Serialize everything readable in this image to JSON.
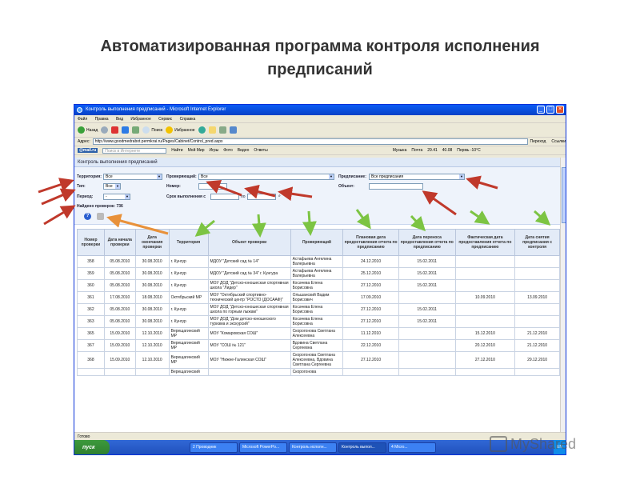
{
  "slide": {
    "title_line1": "Автоматизированная программа контроля исполнения",
    "title_line2": "предписаний"
  },
  "window": {
    "title": "Контроль выполнения предписаний - Microsoft Internet Explorer",
    "menu": [
      "Файл",
      "Правка",
      "Вид",
      "Избранное",
      "Сервис",
      "Справка"
    ],
    "toolbar": [
      "Назад",
      "Поиск",
      "Избранное"
    ],
    "address_label": "Адрес:",
    "address_value": "http://www.goodmedrabot.permkrai.ru/Pages/Cabinet/Control_pred.aspx",
    "go_label": "Переход",
    "links_label": "Ссылки",
    "links": {
      "mail": "@mail.ru",
      "search_placeholder": "Поиск в Интернете",
      "find": "Найти",
      "items": [
        "Мой Мир",
        "Игры",
        "Фото",
        "Видео",
        "Ответы",
        "Музыка",
        "Почта",
        "29.41",
        "40.08",
        "Пермь -10°C"
      ]
    }
  },
  "page": {
    "header": "Контроль выполнения предписаний",
    "filters": {
      "territory_label": "Территория:",
      "territory_value": "Все",
      "inspector_label": "Проверяющий:",
      "inspector_value": "Все",
      "prescription_label": "Предписание:",
      "prescription_value": "Все предписания",
      "type_label": "Тип:",
      "type_value": "Все",
      "number_label": "Номер:",
      "object_label": "Объект:",
      "period_label": "Период:",
      "period_value": "-",
      "deadline_label": "Срок выполнения с",
      "deadline_to": "по",
      "found": "Найдено проверок: 736"
    },
    "columns": [
      "Номер проверки",
      "Дата начала проверки",
      "Дата окончания проверки",
      "Территория",
      "Объект проверки",
      "Проверяющий",
      "Плановая дата предоставления отчета по предписанию",
      "Дата переноса предоставления отчета по предписанию",
      "Фактическая дата предоставления отчета по предписанию",
      "Дата снятия предписания с контроля"
    ],
    "rows": [
      [
        "358",
        "05.08.2010",
        "30.08.2010",
        "г. Кунгур",
        "МДОУ \"Детский сад № 14\"",
        "Астафьева Ангелина Валерьевна",
        "24.12.2010",
        "15.02.2011",
        "",
        ""
      ],
      [
        "359",
        "05.08.2010",
        "30.08.2010",
        "г. Кунгур",
        "МДОУ \"Детский сад № 34\" г. Кунгура",
        "Астафьева Ангелина Валерьевна",
        "25.12.2010",
        "15.02.2011",
        "",
        ""
      ],
      [
        "360",
        "05.08.2010",
        "30.08.2010",
        "г. Кунгур",
        "МОУ ДОД \"Детско-юношеская спортивная школа \"Лидер\"",
        "Косачева Елена Борисовна",
        "27.12.2010",
        "15.02.2011",
        "",
        ""
      ],
      [
        "361",
        "17.08.2010",
        "18.08.2010",
        "Октябрьский МР",
        "МОУ \"Октябрьский спортивно-технический центр \"РОСТО (ДОСААФ)\"",
        "Ольшанский Вадим Борисович",
        "17.09.2010",
        "",
        "10.09.2010",
        "13.09.2010"
      ],
      [
        "362",
        "05.08.2010",
        "30.08.2010",
        "г. Кунгур",
        "МОУ ДОД \"Детско-юношеская спортивная школа по горным лыжам\"",
        "Косачева Елена Борисовна",
        "27.12.2010",
        "15.02.2011",
        "",
        ""
      ],
      [
        "363",
        "05.08.2010",
        "30.08.2010",
        "г. Кунгур",
        "МОУ ДОД \"Дом детско-юношеского туризма и экскурсий\"",
        "Косачева Елена Борисовна",
        "27.12.2010",
        "15.02.2011",
        "",
        ""
      ],
      [
        "365",
        "15.09.2010",
        "12.10.2010",
        "Верещагинский МР",
        "МОУ \"Комаровская СОШ\"",
        "Скорогонова Светлана Алексеевна",
        "11.12.2010",
        "",
        "15.12.2010",
        "21.12.2010"
      ],
      [
        "367",
        "15.09.2010",
        "12.10.2010",
        "Верещагинский МР",
        "МОУ \"СОШ № 121\"",
        "Вдовина Светлана Сергеевна",
        "22.12.2010",
        "",
        "20.12.2010",
        "21.12.2010"
      ],
      [
        "368",
        "15.09.2010",
        "12.10.2010",
        "Верещагинский МР",
        "МОУ \"Нижне-Галинская СОШ\"",
        "Скорогонова Светлана Алексеевна, Вдовина Светлана Сергеевна",
        "27.12.2010",
        "",
        "27.12.2010",
        "29.12.2010"
      ],
      [
        "",
        "",
        "",
        "Верещагинский",
        "",
        "Скорогонова",
        "",
        "",
        "",
        ""
      ]
    ],
    "status": "Готово"
  },
  "taskbar": {
    "start": "пуск",
    "tasks": [
      "2 Проводник",
      "Microsoft PowerPo...",
      "Контроль исполн...",
      "Контроль выпол...",
      "4 Micro..."
    ],
    "tray": "EN"
  },
  "watermark": "MyShared",
  "colors": {
    "arrow_red": "#c0392b",
    "arrow_green": "#7cc443",
    "arrow_orange": "#e8913a",
    "header_bg": "#e3ebf7"
  }
}
